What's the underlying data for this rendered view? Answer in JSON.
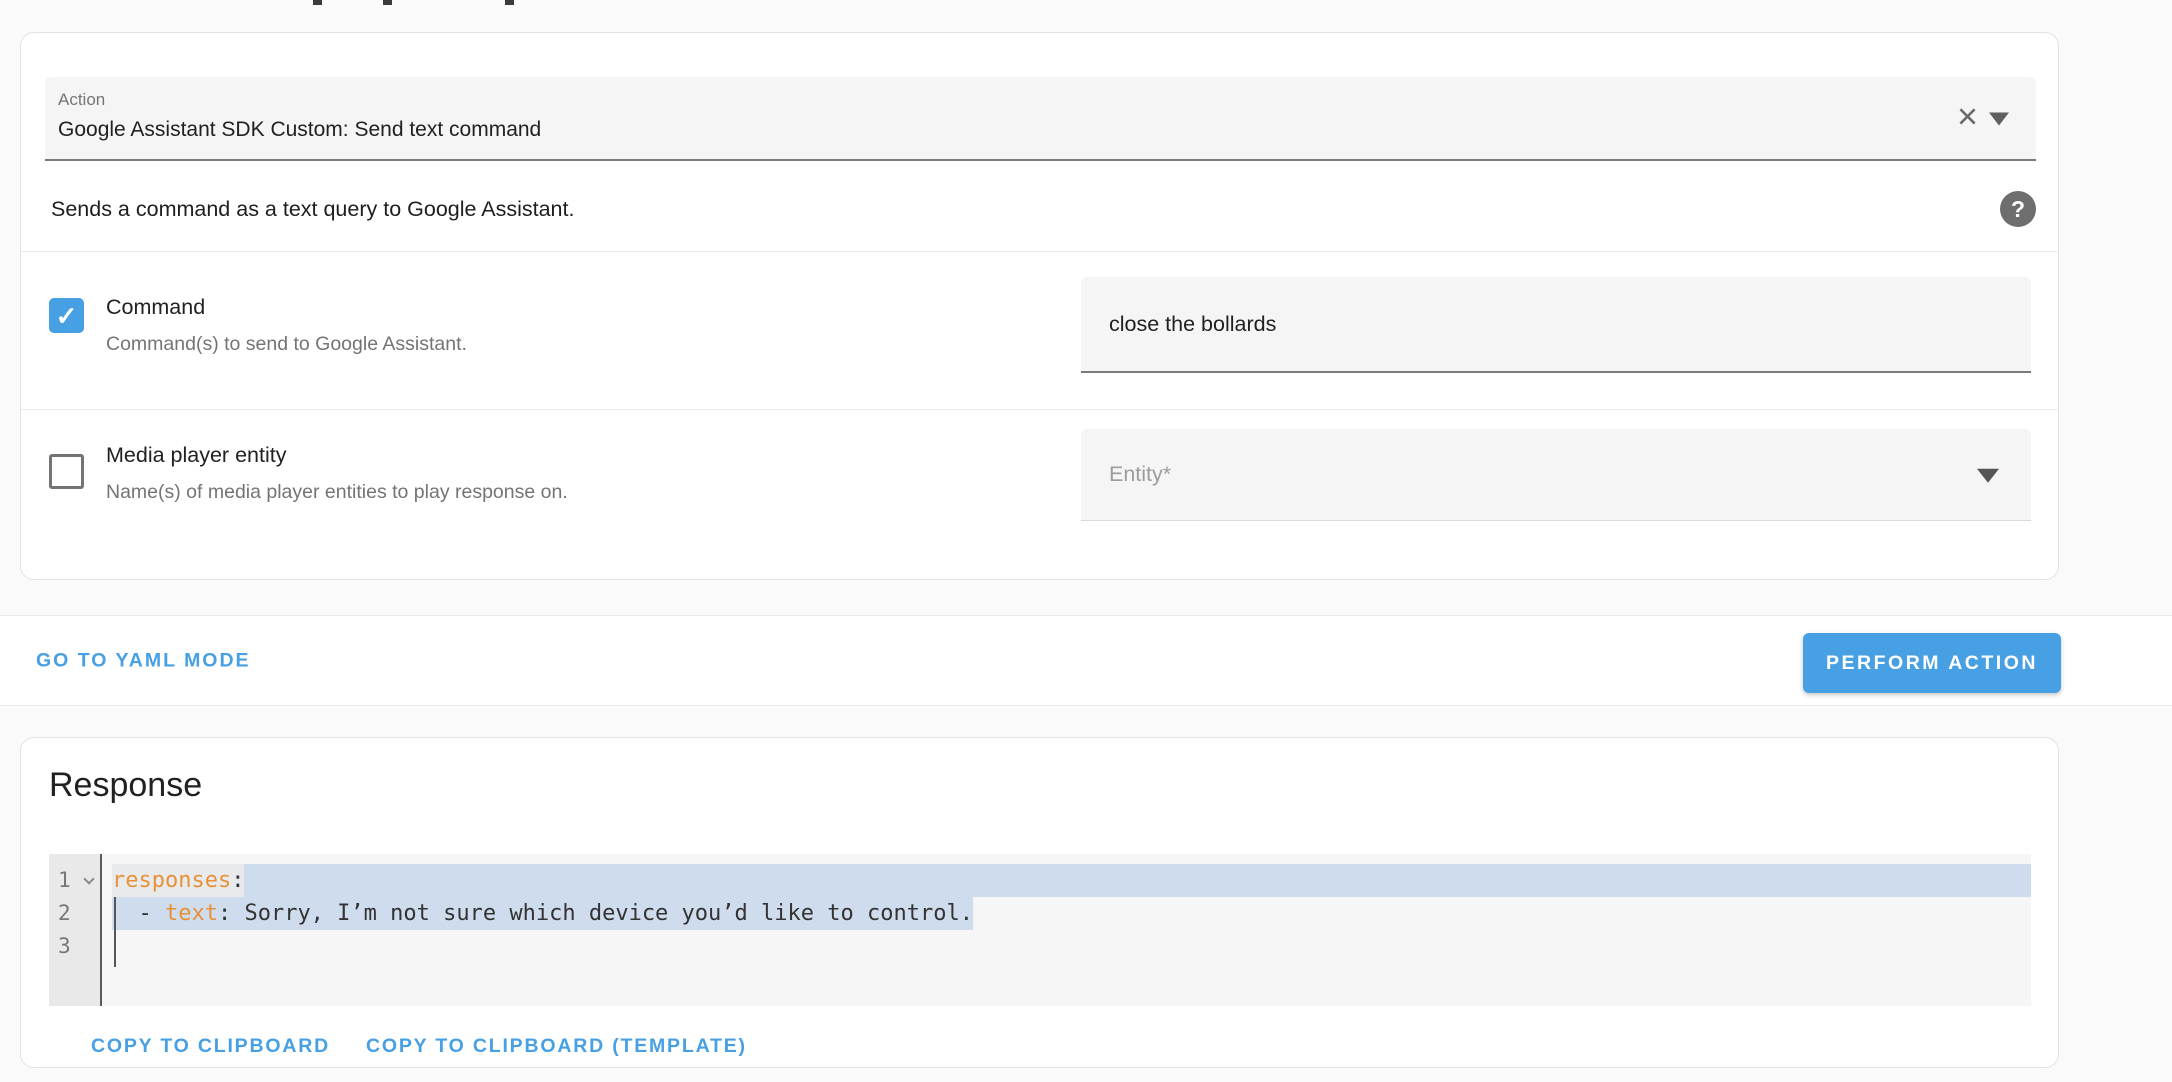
{
  "colors": {
    "accent": "#47a0e3",
    "token_orange": "#e8913a",
    "selection_blue": "#cedced",
    "page_bg": "#fafafa"
  },
  "icons": {
    "clear": "×",
    "help": "?",
    "check": "✓",
    "action_dropdown": "caret-down",
    "entity_dropdown": "caret-down",
    "fold": "chevron-down"
  },
  "action_card": {
    "action_label": "Action",
    "action_value": "Google Assistant SDK Custom: Send text command",
    "description": "Sends a command as a text query to Google Assistant.",
    "command": {
      "title": "Command",
      "description": "Command(s) to send to Google Assistant.",
      "value": "close the bollards",
      "checked": true
    },
    "media_player": {
      "title": "Media player entity",
      "description": "Name(s) of media player entities to play response on.",
      "placeholder": "Entity*",
      "checked": false
    }
  },
  "toolbar": {
    "yaml_mode_label": "GO TO YAML MODE",
    "perform_label": "PERFORM ACTION"
  },
  "response_card": {
    "title": "Response",
    "editor": {
      "line1": {
        "number": "1",
        "key": "responses",
        "punct": ":"
      },
      "line2": {
        "number": "2",
        "indent_dash": "  - ",
        "key": "text",
        "rest": ": Sorry, I’m not sure which device you’d like to control."
      },
      "line3": {
        "number": "3"
      }
    },
    "copy_label": "COPY TO CLIPBOARD",
    "copy_template_label": "COPY TO CLIPBOARD (TEMPLATE)"
  }
}
